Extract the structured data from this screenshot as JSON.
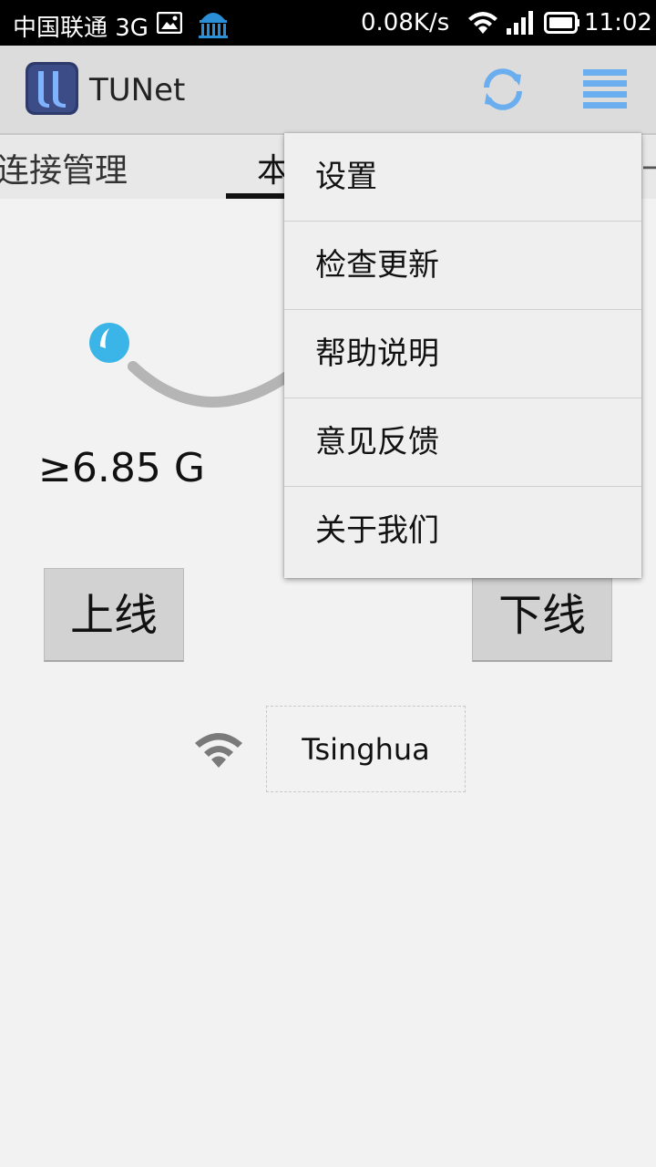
{
  "status_bar": {
    "carrier": "中国联通 3G",
    "speed": "0.08K/s",
    "time": "11:02",
    "icons": [
      "gallery-icon",
      "app-notification-icon",
      "wifi-icon",
      "signal-icon",
      "battery-icon"
    ]
  },
  "action_bar": {
    "title": "TUNet",
    "icons": [
      "app-logo-icon",
      "refresh-icon",
      "menu-icon"
    ],
    "accent_color": "#6aaef0"
  },
  "tabs": [
    {
      "label": "连接管理"
    },
    {
      "label": "本",
      "selected": true
    },
    {
      "label": "十"
    }
  ],
  "main": {
    "usage": "≥6.85 G",
    "online_button": "上线",
    "offline_button": "下线",
    "ssid": "Tsinghua",
    "gauge_color": "#3bb5e8"
  },
  "overflow_menu": {
    "items": [
      {
        "label": "设置"
      },
      {
        "label": "检查更新"
      },
      {
        "label": "帮助说明"
      },
      {
        "label": "意见反馈"
      },
      {
        "label": "关于我们"
      }
    ]
  }
}
